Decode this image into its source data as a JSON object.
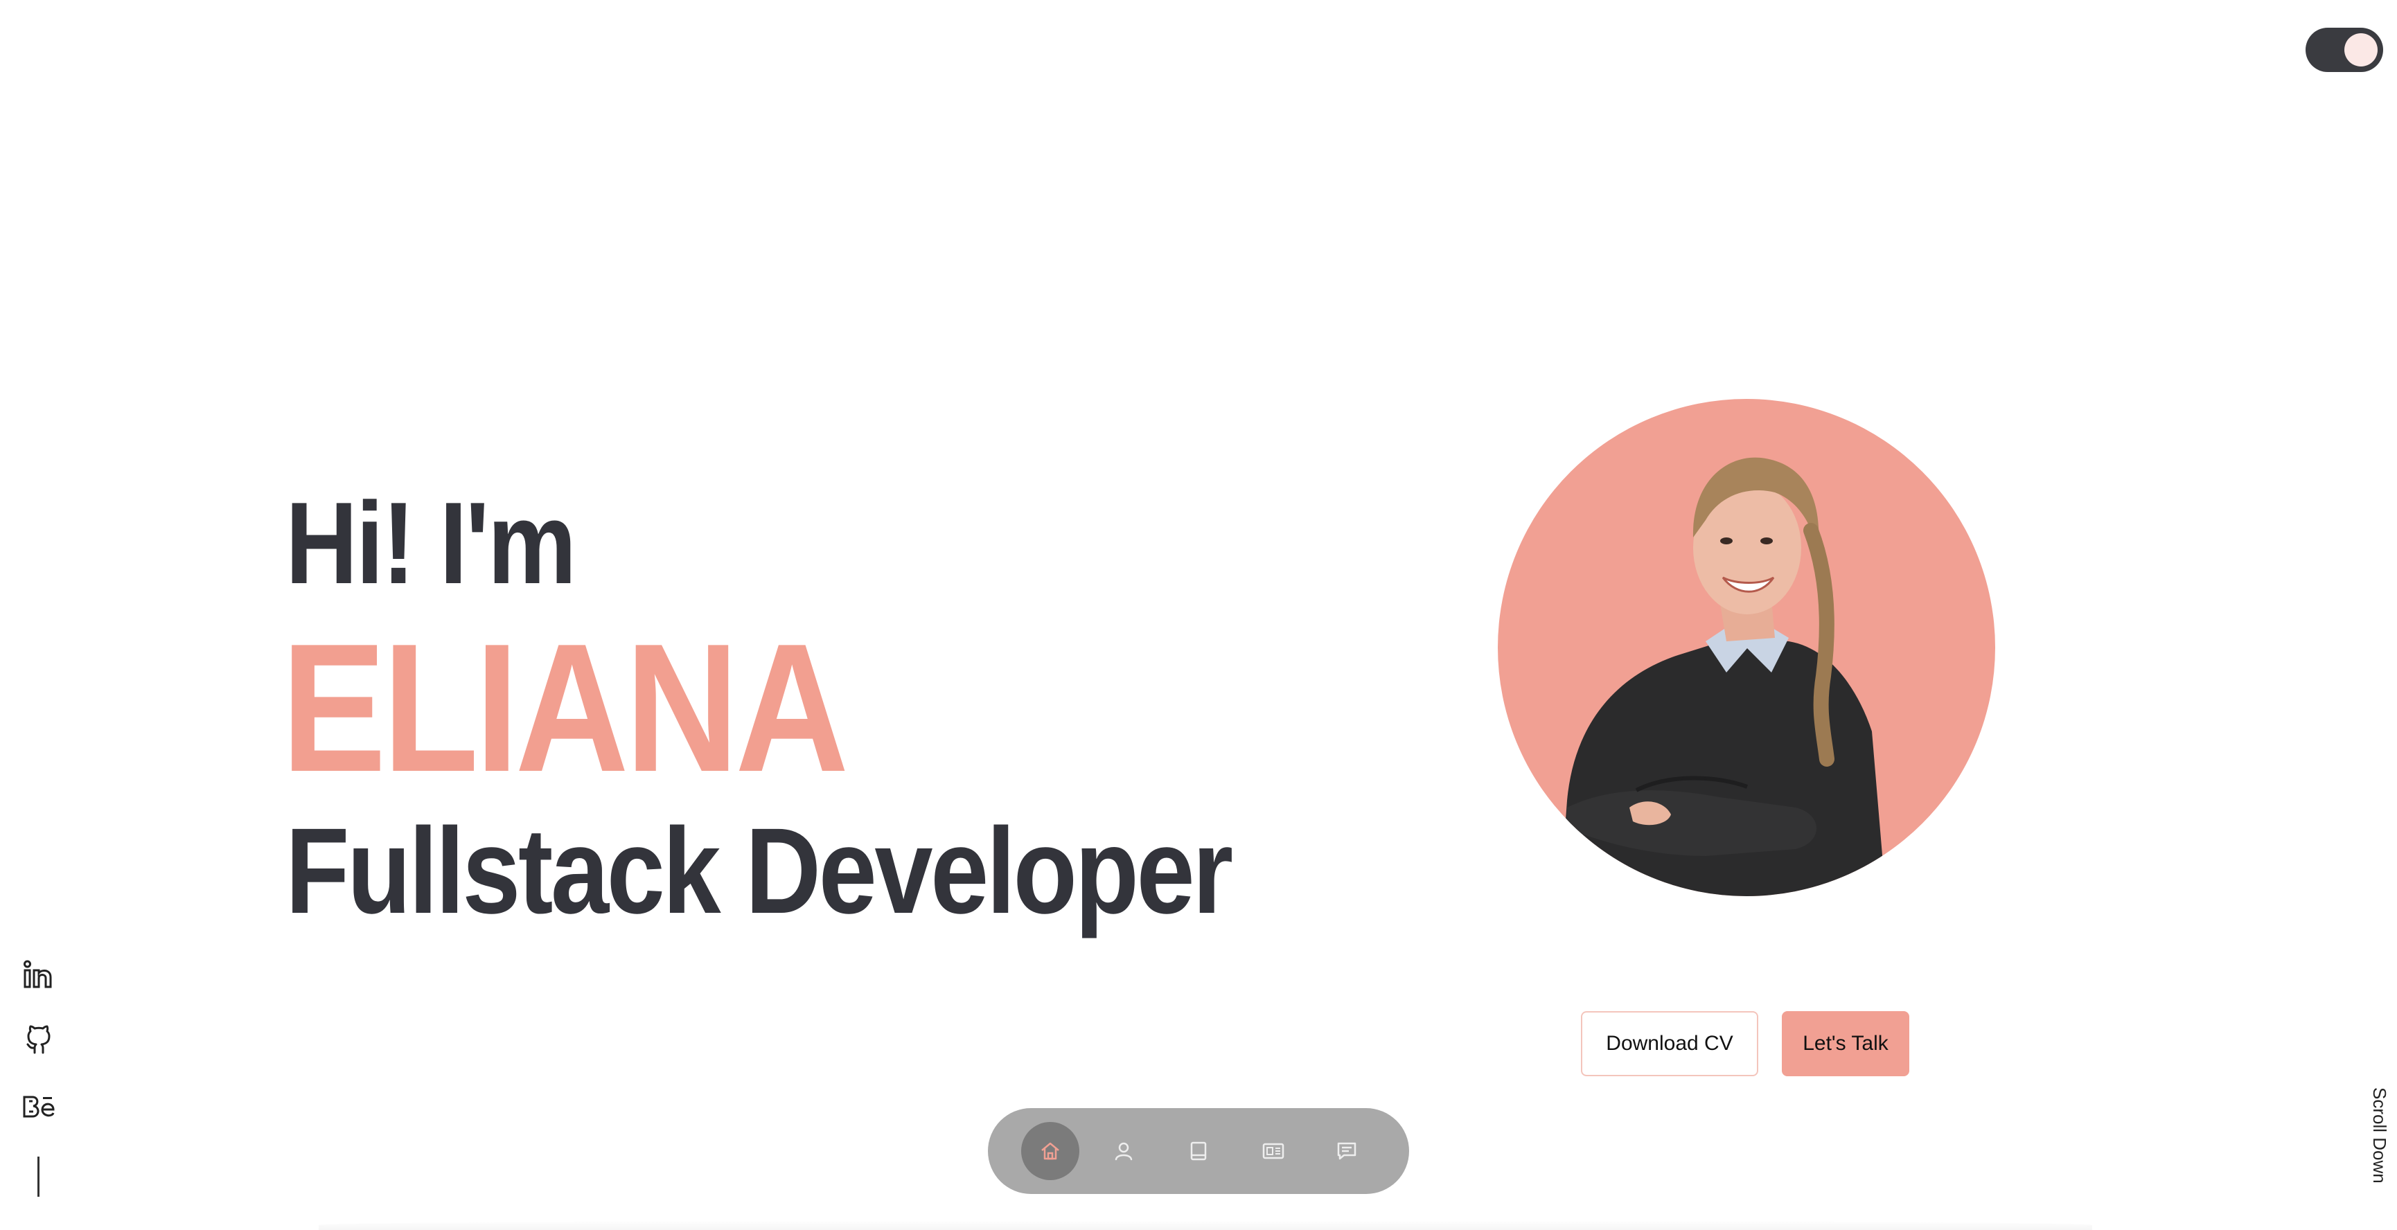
{
  "hero": {
    "greeting": "Hi! I'm",
    "name": "ELIANA",
    "role": "Fullstack Developer"
  },
  "buttons": {
    "download_cv": "Download CV",
    "lets_talk": "Let's Talk"
  },
  "scroll_label": "Scroll Down",
  "social_icons": [
    "linkedin-icon",
    "github-icon",
    "behance-icon"
  ],
  "nav_items": [
    "home-icon",
    "user-icon",
    "book-icon",
    "news-icon",
    "message-icon"
  ],
  "colors": {
    "accent": "#f1a093",
    "dark_text": "#33343b",
    "nav_background": "#a9a9a9",
    "nav_active": "#7b7b7b",
    "toggle_background": "#3a3b40"
  }
}
